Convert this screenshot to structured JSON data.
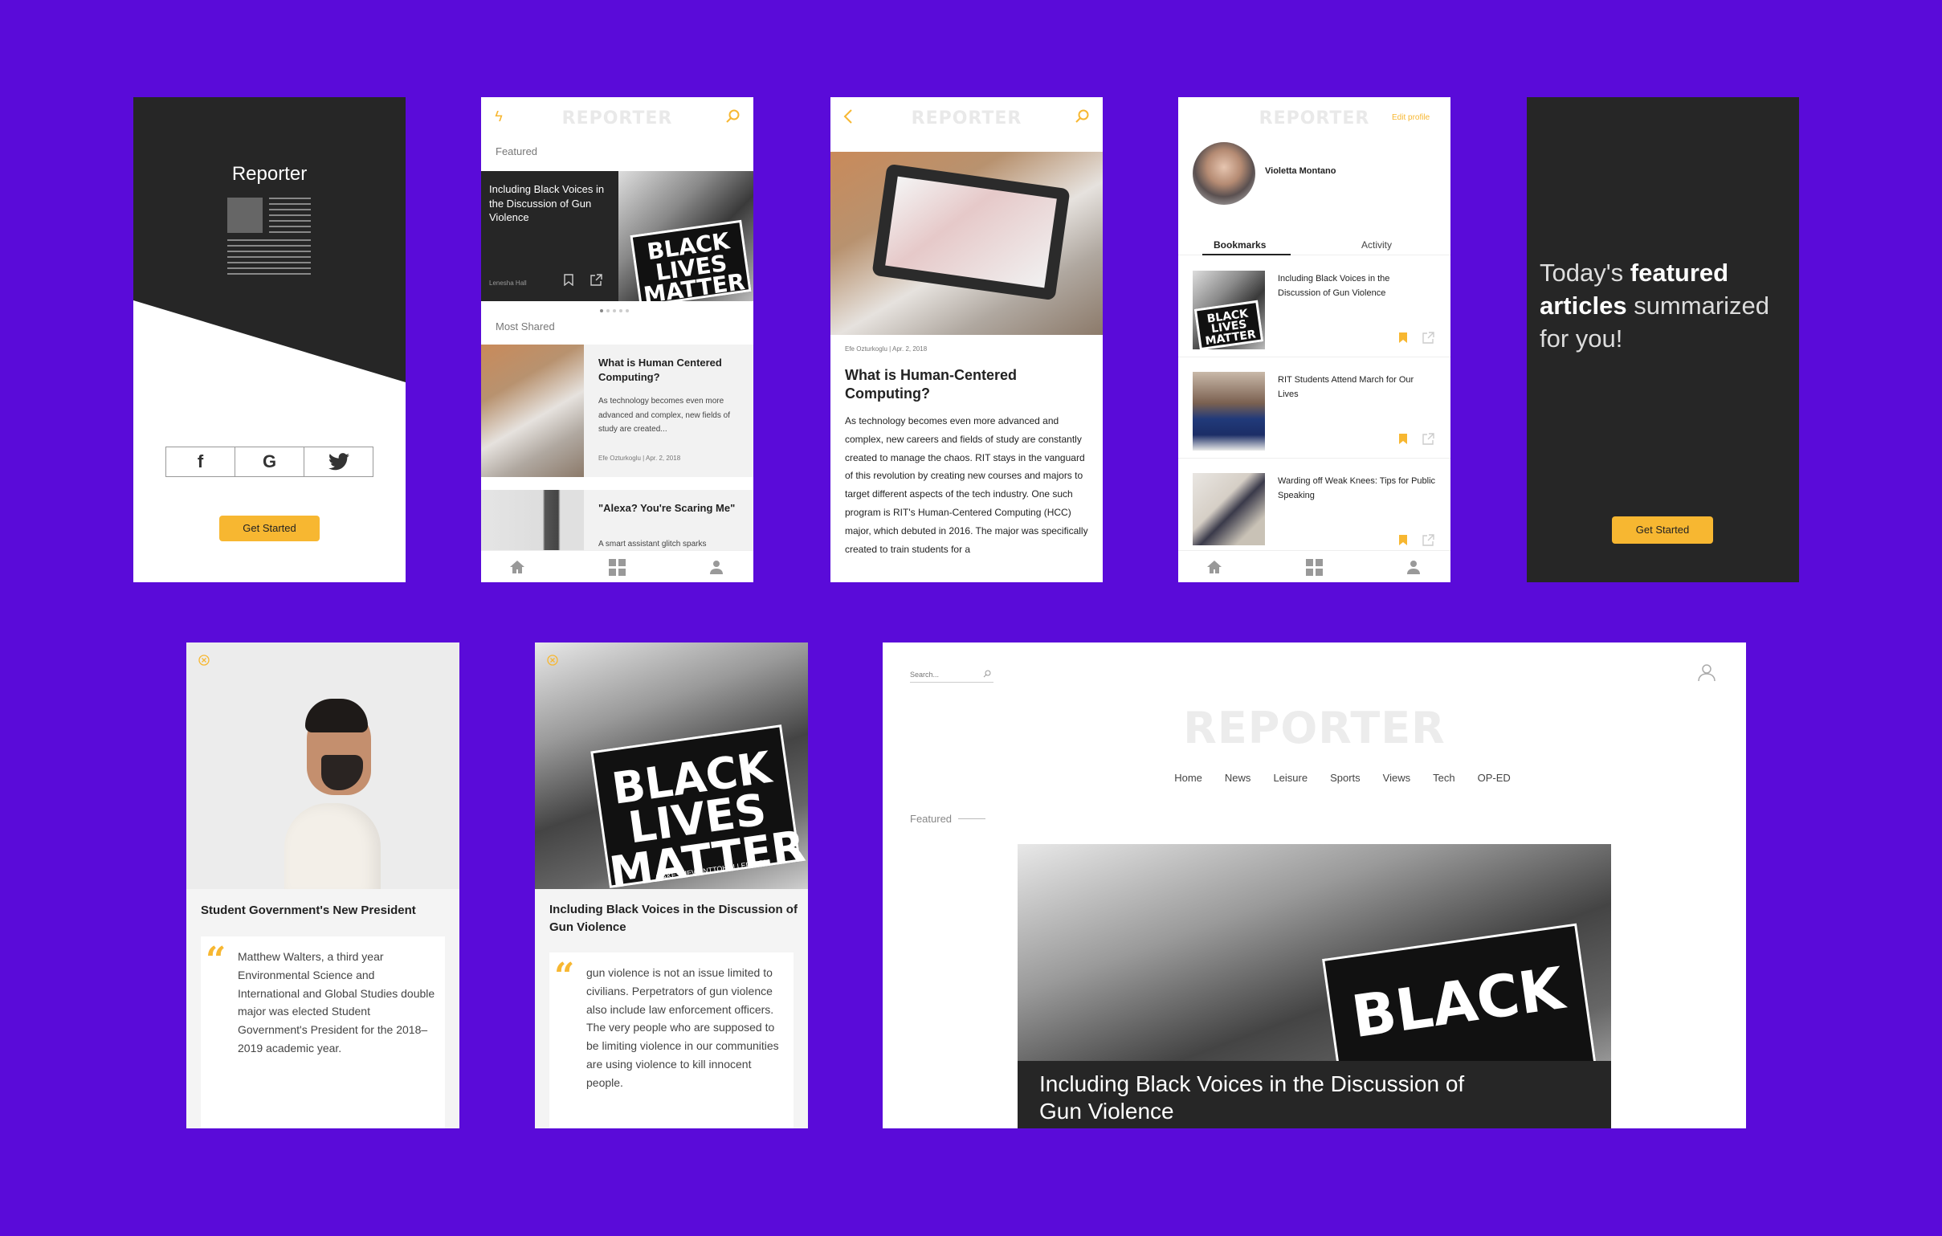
{
  "s1": {
    "title": "Reporter",
    "cta": "Get Started",
    "social": [
      "f",
      "G",
      "twitter-bird"
    ]
  },
  "s2": {
    "logo": "REPORTER",
    "featured_label": "Featured",
    "featured": {
      "title": "Including Black Voices in the Discussion of Gun Violence",
      "author": "Lenesha Hall"
    },
    "sign": "BLACK LIVES MATTER",
    "most_shared_label": "Most Shared",
    "items": [
      {
        "title": "What is Human Centered Computing?",
        "excerpt": "As technology becomes even more advanced and complex, new fields of study are created...",
        "meta": "Efe Ozturkoglu | Apr. 2, 2018"
      },
      {
        "title": "\"Alexa? You're Scaring Me\"",
        "excerpt": "A smart assistant glitch sparks"
      }
    ]
  },
  "s3": {
    "logo": "REPORTER",
    "meta": "Efe Ozturkoglu | Apr. 2, 2018",
    "title": "What is Human-Centered Computing?",
    "body": "As technology becomes even more advanced and complex, new careers and fields of study are constantly created to manage the chaos. RIT stays in the vanguard of this revolution by creating new courses and majors to target different aspects of the tech industry. One such program is RIT's Human-Centered Computing (HCC) major, which debuted in 2016. The major was specifically created to train students for a"
  },
  "s4": {
    "logo": "REPORTER",
    "edit": "Edit profile",
    "name": "Violetta Montano",
    "tabs": [
      "Bookmarks",
      "Activity"
    ],
    "items": [
      {
        "title": "Including Black Voices in the Discussion of Gun Violence"
      },
      {
        "title": "RIT Students Attend March for Our Lives"
      },
      {
        "title": "Warding off Weak Knees: Tips for Public Speaking"
      }
    ],
    "sign": "BLACK LIVES MATTER"
  },
  "s5": {
    "w1": "Today's ",
    "w2": "featured",
    "w3": "articles",
    "w4": " summarized",
    "w5": "for you!",
    "cta": "Get Started"
  },
  "s6": {
    "title": "Student Government's New President",
    "quote": "Matthew Walters, a third year Environmental Science and International and Global Studies double major was elected Student Government's President for the 2018–2019 academic year."
  },
  "s7": {
    "title": "Including Black Voices in the Discussion of Gun Violence",
    "quote": "gun violence is not an issue limited to civilians. Perpetrators of gun violence also include law enforcement officers. The very people who are supposed to be limiting violence in our communities are using violence to kill innocent people.",
    "sign": "BLACK LIVES MATTER",
    "sign_url": "MAKESMEWANTTOHOLLER.COM"
  },
  "s8": {
    "search_placeholder": "Search...",
    "logo": "REPORTER",
    "nav": [
      "Home",
      "News",
      "Leisure",
      "Sports",
      "Views",
      "Tech",
      "OP-ED"
    ],
    "featured_label": "Featured",
    "hero_title": "Including Black Voices in the Discussion of Gun Violence",
    "sign": "BLACK"
  },
  "colors": {
    "accent": "#f7b731",
    "background": "#5a0bd9",
    "dark": "#262626"
  }
}
